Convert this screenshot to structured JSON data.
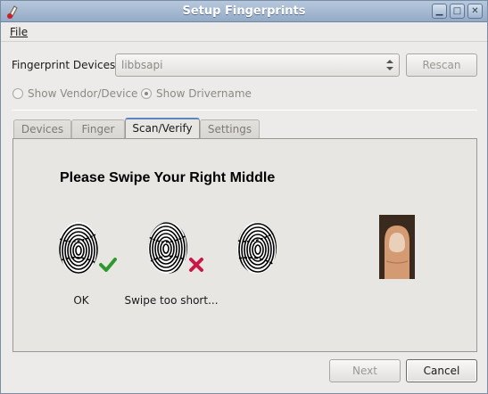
{
  "window": {
    "title": "Setup Fingerprints"
  },
  "menubar": {
    "file": "File"
  },
  "devices": {
    "label": "Fingerprint Devices:",
    "selected": "libbsapi",
    "rescan": "Rescan"
  },
  "radios": {
    "vendor": "Show Vendor/Device",
    "drivername": "Show Drivername",
    "selected": "drivername"
  },
  "tabs": [
    {
      "label": "Devices"
    },
    {
      "label": "Finger"
    },
    {
      "label": "Scan/Verify"
    },
    {
      "label": "Settings"
    }
  ],
  "active_tab": "Scan/Verify",
  "scan": {
    "instruction": "Please Swipe Your Right Middle",
    "attempts": [
      {
        "status": "ok",
        "caption": "OK"
      },
      {
        "status": "error",
        "caption": "Swipe too short..."
      },
      {
        "status": "pending",
        "caption": ""
      }
    ]
  },
  "footer": {
    "next": "Next",
    "cancel": "Cancel"
  },
  "colors": {
    "ok": "#2e9a2e",
    "error": "#c8184a",
    "accent": "#5d86c0"
  },
  "icons": [
    "app-icon",
    "minimize-icon",
    "maximize-icon",
    "close-icon",
    "combo-arrows-icon",
    "checkmark-icon",
    "cross-icon",
    "fingerprint-icon",
    "finger-photo"
  ]
}
